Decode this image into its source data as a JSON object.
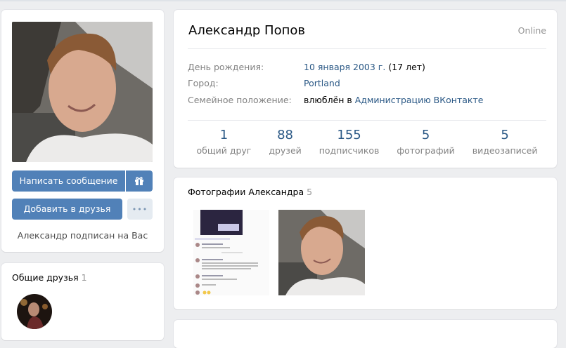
{
  "profile": {
    "name": "Александр Попов",
    "status": "Online",
    "birthday_label": "День рождения:",
    "birthday_value": "10 января 2003 г.",
    "birthday_age": " (17 лет)",
    "city_label": "Город:",
    "city_value": "Portland",
    "relationship_label": "Семейное положение:",
    "relationship_prefix": "влюблён в ",
    "relationship_link": "Администрацию ВКонтакте"
  },
  "counters": [
    {
      "num": "1",
      "caption": "общий друг"
    },
    {
      "num": "88",
      "caption": "друзей"
    },
    {
      "num": "155",
      "caption": "подписчиков"
    },
    {
      "num": "5",
      "caption": "фотографий"
    },
    {
      "num": "5",
      "caption": "видеозаписей"
    }
  ],
  "actions": {
    "message": "Написать сообщение",
    "add_friend": "Добавить в друзья",
    "more": "•••",
    "subscribed_text": "Александр подписан на Вас"
  },
  "mutual_friends": {
    "title": "Общие друзья",
    "count": "1"
  },
  "photos": {
    "title": "Фотографии Александра",
    "count": "5"
  },
  "colors": {
    "accent": "#5181b8",
    "link": "#2a5885",
    "background": "#edeef0"
  },
  "icons": {
    "gift": "gift-icon",
    "more": "more-dots-icon"
  }
}
